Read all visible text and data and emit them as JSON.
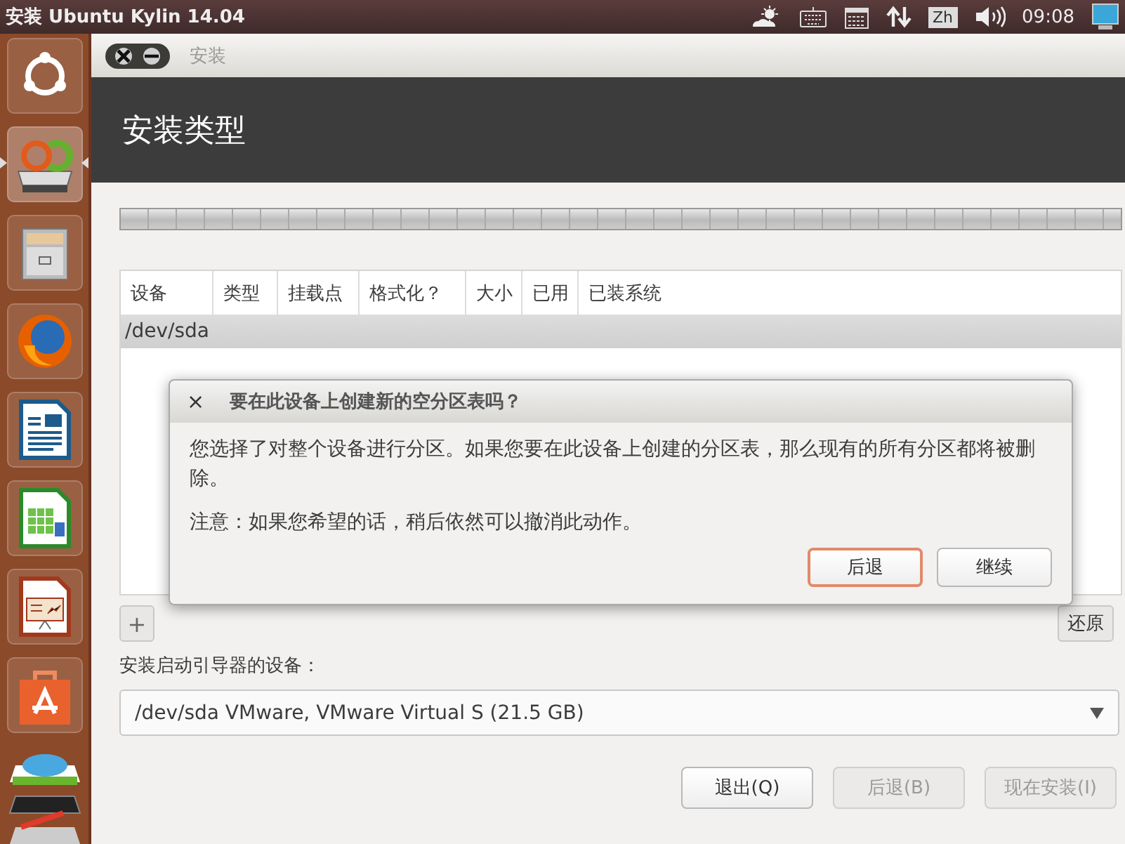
{
  "top_bar": {
    "title": "安装 Ubuntu Kylin 14.04",
    "indicators": [
      {
        "kind": "weather"
      },
      {
        "kind": "keyboard"
      },
      {
        "kind": "calendar"
      },
      {
        "kind": "network"
      },
      {
        "kind": "input",
        "text": "Zh"
      },
      {
        "kind": "volume"
      },
      {
        "kind": "clock",
        "text": "09:08"
      },
      {
        "kind": "display"
      }
    ]
  },
  "launcher": [
    {
      "kind": "dash",
      "active": false
    },
    {
      "kind": "installer",
      "active": true
    },
    {
      "kind": "files",
      "active": false
    },
    {
      "kind": "browser",
      "active": false
    },
    {
      "kind": "writer",
      "active": false
    },
    {
      "kind": "calc",
      "active": false
    },
    {
      "kind": "impress",
      "active": false
    },
    {
      "kind": "store",
      "active": false
    },
    {
      "kind": "stack"
    }
  ],
  "window": {
    "title": "安装",
    "header": "安装类型"
  },
  "partition_table": {
    "columns": [
      "设备",
      "类型",
      "挂载点",
      "格式化？",
      "大小",
      "已用",
      "已装系统"
    ],
    "rows": [
      {
        "device": "/dev/sda",
        "selected": true
      }
    ]
  },
  "partition_toolbar": {
    "add": "+",
    "revert": "还原"
  },
  "bootloader": {
    "label": "安装启动引导器的设备：",
    "value": "/dev/sda  VMware, VMware Virtual S (21.5 GB)"
  },
  "buttons": [
    {
      "label": "退出(Q)",
      "disabled": false
    },
    {
      "label": "后退(B)",
      "disabled": true
    },
    {
      "label": "现在安装(I)",
      "disabled": true
    }
  ],
  "dialog": {
    "close": "×",
    "title": "要在此设备上创建新的空分区表吗？",
    "message": "您选择了对整个设备进行分区。如果您要在此设备上创建的分区表，那么现有的所有分区都将被删除。",
    "note": "注意：如果您希望的话，稍后依然可以撤消此动作。",
    "buttons": [
      {
        "label": "后退",
        "default": true
      },
      {
        "label": "继续",
        "default": false
      }
    ]
  }
}
